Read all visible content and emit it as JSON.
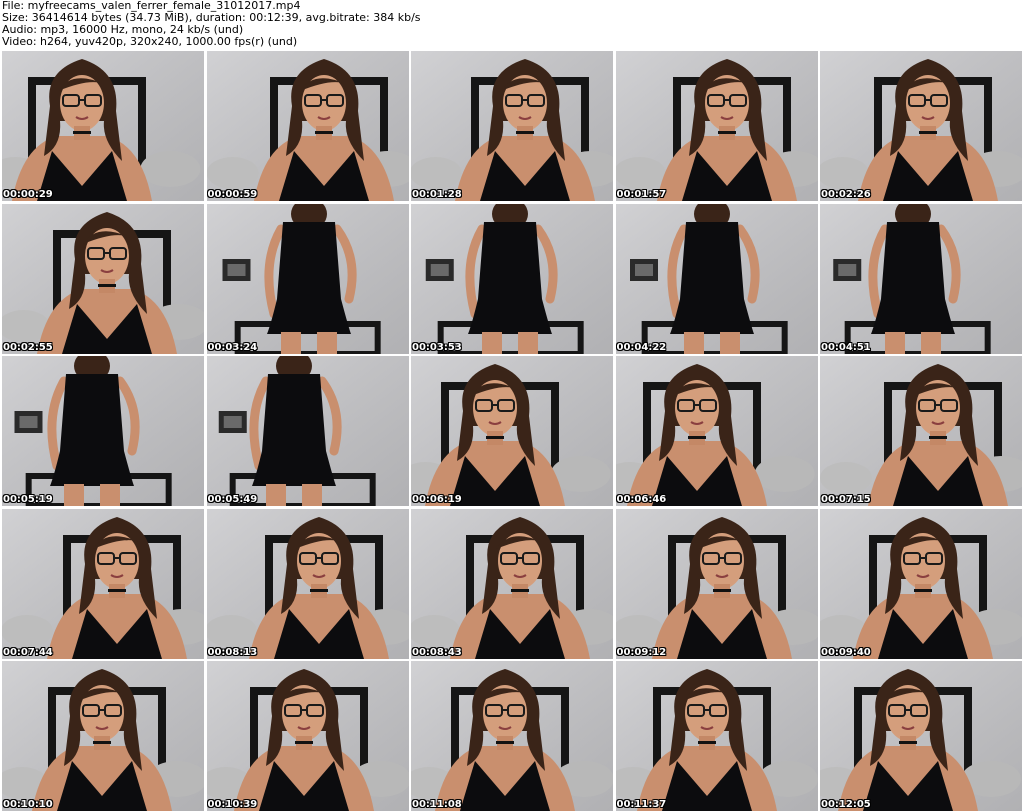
{
  "header": {
    "file": "File: myfreecams_valen_ferrer_female_31012017.mp4",
    "size": "Size: 36414614 bytes (34.73 MiB), duration: 00:12:39, avg.bitrate: 384 kb/s",
    "audio": "Audio: mp3, 16000 Hz, mono, 24 kb/s (und)",
    "video": "Video: h264, yuv420p, 320x240, 1000.00 fps(r) (und)"
  },
  "thumbnails": [
    {
      "time": "00:00:29",
      "scene": "closeup"
    },
    {
      "time": "00:00:59",
      "scene": "closeup"
    },
    {
      "time": "00:01:28",
      "scene": "closeup"
    },
    {
      "time": "00:01:57",
      "scene": "closeup"
    },
    {
      "time": "00:02:26",
      "scene": "closeup"
    },
    {
      "time": "00:02:55",
      "scene": "closeup"
    },
    {
      "time": "00:03:24",
      "scene": "standing"
    },
    {
      "time": "00:03:53",
      "scene": "standing"
    },
    {
      "time": "00:04:22",
      "scene": "standing"
    },
    {
      "time": "00:04:51",
      "scene": "standing"
    },
    {
      "time": "00:05:19",
      "scene": "standing"
    },
    {
      "time": "00:05:49",
      "scene": "standing"
    },
    {
      "time": "00:06:19",
      "scene": "closeup"
    },
    {
      "time": "00:06:46",
      "scene": "closeup"
    },
    {
      "time": "00:07:15",
      "scene": "closeup"
    },
    {
      "time": "00:07:44",
      "scene": "closeup"
    },
    {
      "time": "00:08:13",
      "scene": "closeup"
    },
    {
      "time": "00:08:43",
      "scene": "closeup"
    },
    {
      "time": "00:09:12",
      "scene": "closeup"
    },
    {
      "time": "00:09:40",
      "scene": "closeup"
    },
    {
      "time": "00:10:10",
      "scene": "closeup"
    },
    {
      "time": "00:10:39",
      "scene": "closeup"
    },
    {
      "time": "00:11:08",
      "scene": "closeup"
    },
    {
      "time": "00:11:37",
      "scene": "closeup"
    },
    {
      "time": "00:12:05",
      "scene": "closeup"
    }
  ],
  "colors": {
    "wall": "#c9c9cc",
    "skin": "#c98f6e",
    "hair": "#3a2418",
    "dress": "#0c0c0e",
    "headboard": "#151515"
  }
}
